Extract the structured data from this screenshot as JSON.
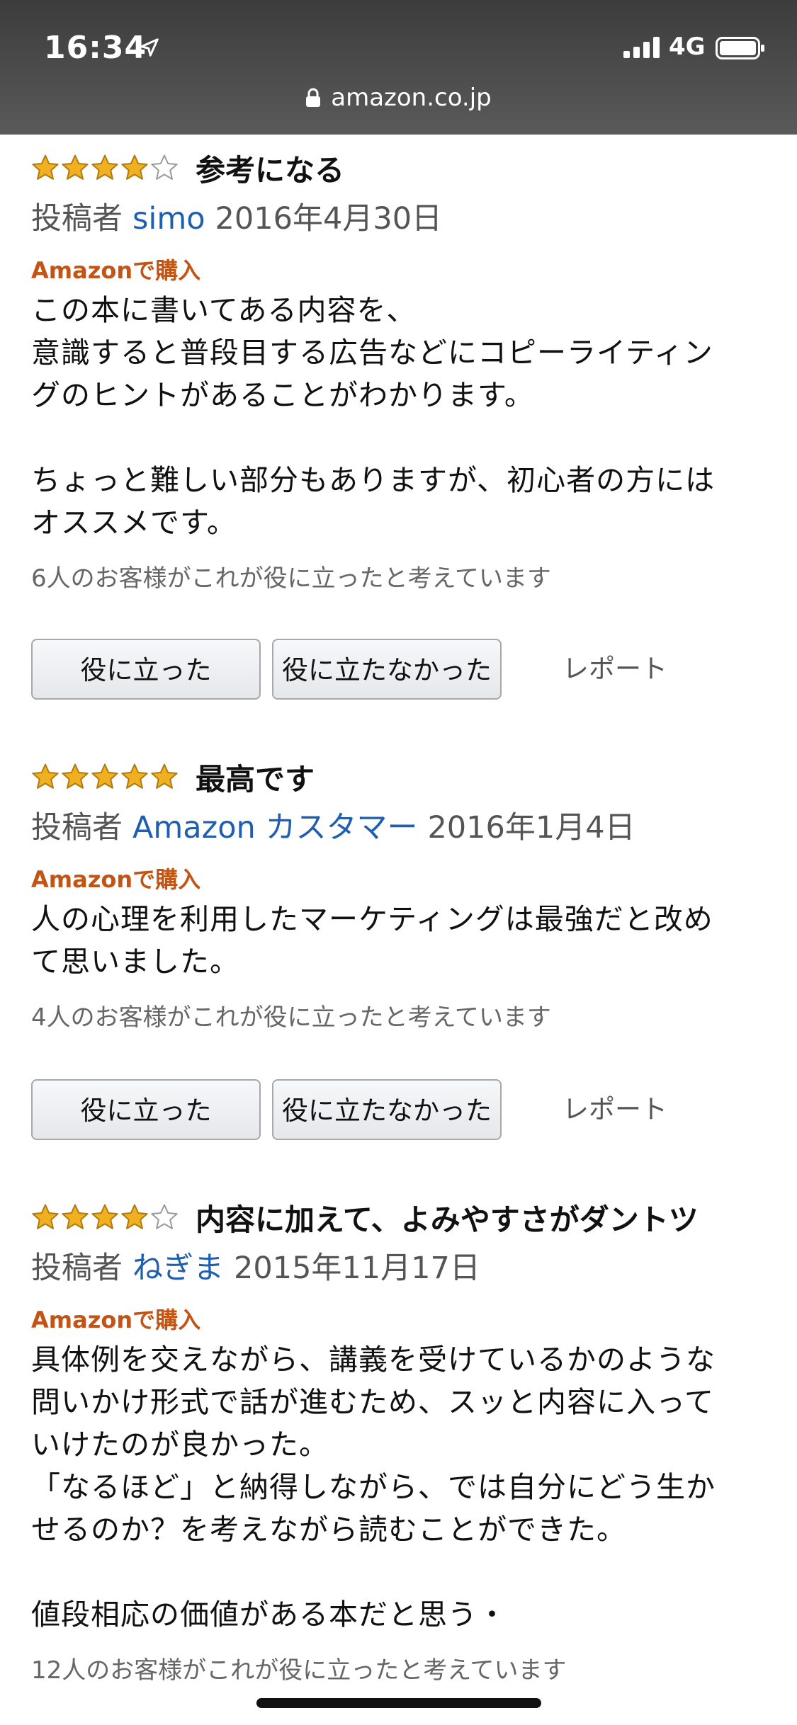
{
  "status_bar": {
    "time": "16:34",
    "network": "4G"
  },
  "url_bar": {
    "domain": "amazon.co.jp"
  },
  "colors": {
    "star": "#f0b020",
    "author_link": "#1f5fb0",
    "purchase_badge": "#c25515"
  },
  "reviews": [
    {
      "rating": 4,
      "title": "参考になる",
      "by": "投稿者",
      "author": "simo",
      "date": "2016年4月30日",
      "badge": "Amazonで購入",
      "body": "この本に書いてある内容を、\n意識すると普段目する広告などにコピーライティン\nグのヒントがあることがわかります。\n\nちょっと難しい部分もありますが、初心者の方には\nオススメです。",
      "helpful": "6人のお客様がこれが役に立ったと考えています",
      "helpful_button": "役に立った",
      "not_helpful_button": "役に立たなかった",
      "report": "レポート"
    },
    {
      "rating": 5,
      "title": "最高です",
      "by": "投稿者",
      "author": "Amazon カスタマー",
      "date": "2016年1月4日",
      "badge": "Amazonで購入",
      "body": "人の心理を利用したマーケティングは最強だと改め\nて思いました。",
      "helpful": "4人のお客様がこれが役に立ったと考えています",
      "helpful_button": "役に立った",
      "not_helpful_button": "役に立たなかった",
      "report": "レポート"
    },
    {
      "rating": 4,
      "title": "内容に加えて、よみやすさがダントツ",
      "by": "投稿者",
      "author": "ねぎま",
      "date": "2015年11月17日",
      "badge": "Amazonで購入",
      "body": "具体例を交えながら、講義を受けているかのような\n問いかけ形式で話が進むため、スッと内容に入って\nいけたのが良かった。\n「なるほど」と納得しながら、では自分にどう生か\nせるのか？を考えながら読むことができた。\n\n値段相応の価値がある本だと思う・",
      "helpful": "12人のお客様がこれが役に立ったと考えています"
    }
  ]
}
